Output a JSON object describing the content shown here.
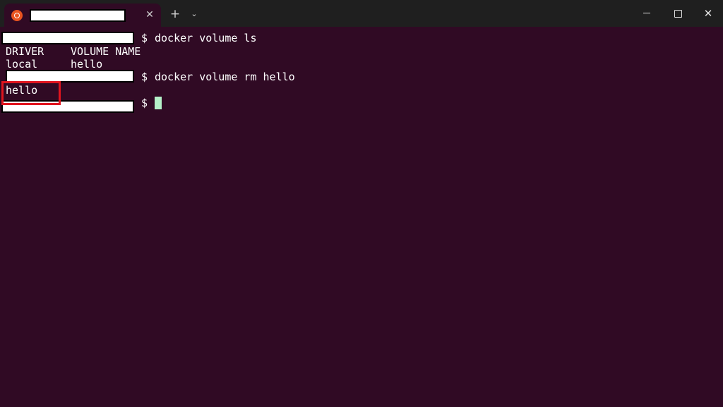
{
  "window": {
    "tab_close_glyph": "✕",
    "new_tab_glyph": "+",
    "dropdown_glyph": "⌄",
    "close_glyph": "✕"
  },
  "terminal": {
    "prompt_symbol": "$",
    "lines": [
      {
        "command": "docker volume ls"
      },
      {
        "header_driver": "DRIVER",
        "header_volume": "VOLUME NAME"
      },
      {
        "driver": "local",
        "volume": "hello"
      },
      {
        "command": "docker volume rm hello"
      },
      {
        "output": "hello"
      }
    ]
  },
  "colors": {
    "background": "#300a24",
    "text": "#ffffff",
    "cursor": "#b4f0c8",
    "highlight": "#e0141e",
    "ubuntu_orange": "#e95420"
  }
}
